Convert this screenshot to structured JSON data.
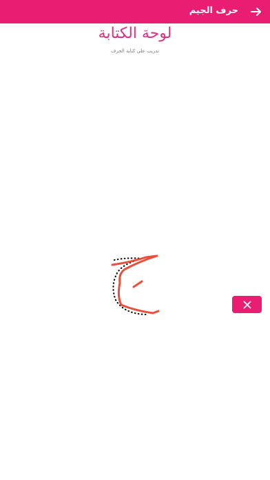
{
  "header": {
    "title": "حرف الجيم",
    "back_icon": "arrow-right-icon",
    "color": "#e91e73"
  },
  "board": {
    "title": "لوحة الكتابة",
    "subtitle": "تدريب على كتابة الحرف",
    "title_color": "#e0317f"
  },
  "canvas": {
    "guide_letter_icon": "dotted-jeem-guide",
    "stroke_color": "#e94f3b"
  },
  "actions": {
    "clear_icon": "close-icon"
  }
}
